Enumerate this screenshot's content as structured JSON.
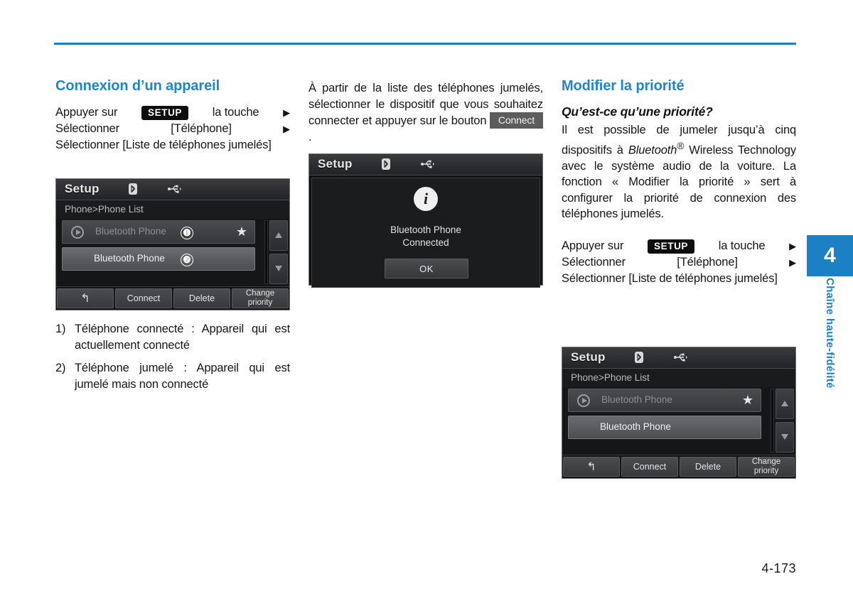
{
  "page": {
    "number": "4-173",
    "accent_color": "#1b81c4",
    "chapter_tab_number": "4",
    "chapter_tab_label": "Chaîne haute-fidélité"
  },
  "left_column": {
    "title": "Connexion d’un appareil",
    "steps": [
      {
        "before": "Appuyer sur",
        "badge": "SETUP",
        "after": "la touche",
        "arrow": "▶"
      },
      {
        "before": "Sélectionner",
        "badge": null,
        "after": "[Téléphone]",
        "arrow": "▶"
      }
    ],
    "step_last": "Sélectionner [Liste de téléphones jumelés]",
    "numbered_items": [
      {
        "marker": "1)",
        "text": "Téléphone connecté : Appareil qui est actuellement connecté"
      },
      {
        "marker": "2)",
        "text": "Téléphone jumelé : Appareil qui est jumelé mais non connecté"
      }
    ]
  },
  "center_column": {
    "paragraph_before": "À partir de la liste des téléphones jumelés, sélectionner le dispositif que vous souhaitez connecter et appuyer sur le bouton",
    "inline_button": "Connect",
    "paragraph_after": "."
  },
  "right_column": {
    "title": "Modifier la priorité",
    "subtitle": "Qu’est-ce qu’une priorité?",
    "paragraph_parts": {
      "p1": "Il est possible de jumeler jusqu’à cinq dispositifs à",
      "italic_brand": "Bluetooth",
      "registered": "®",
      "p2": "Wireless Technology avec le système audio de la voiture. La fonction « Modifier la priorité » sert à configurer la priorité de connexion des téléphones jumelés."
    },
    "steps": [
      {
        "before": "Appuyer sur",
        "badge": "SETUP",
        "after": "la touche",
        "arrow": "▶"
      },
      {
        "before": "Sélectionner",
        "badge": null,
        "after": "[Téléphone]",
        "arrow": "▶"
      }
    ],
    "step_last": "Sélectionner [Liste de téléphones jumelés]"
  },
  "device_phone_list": {
    "title": "Setup",
    "status_icons": {
      "bluetooth": "bluetooth-icon",
      "usb": "usb-icon"
    },
    "breadcrumb": "Phone>Phone List",
    "rows": [
      {
        "label": "Bluetooth Phone",
        "callout": "❶",
        "favorite": "★",
        "state": "connected-dimmed"
      },
      {
        "label": "Bluetooth Phone",
        "callout": "❷",
        "favorite": "",
        "state": "paired-highlight"
      }
    ],
    "scroll_up": "▲",
    "scroll_down": "▼",
    "buttons": [
      {
        "label": "↰",
        "name": "back-button",
        "type": "icon"
      },
      {
        "label": "Connect",
        "name": "connect-button",
        "type": "text"
      },
      {
        "label": "Delete",
        "name": "delete-button",
        "type": "text"
      },
      {
        "label": "Change\npriority",
        "label_line1": "Change",
        "label_line2": "priority",
        "name": "change-priority-button",
        "type": "text2"
      }
    ]
  },
  "device_phone_list_right": {
    "title": "Setup",
    "breadcrumb": "Phone>Phone List",
    "rows": [
      {
        "label": "Bluetooth Phone",
        "favorite": "★",
        "state": "connected-dimmed"
      },
      {
        "label": "Bluetooth Phone",
        "favorite": "",
        "state": "paired-highlight"
      }
    ],
    "scroll_up": "▲",
    "scroll_down": "▼",
    "buttons": [
      {
        "label": "↰",
        "name": "back-button"
      },
      {
        "label": "Connect",
        "name": "connect-button"
      },
      {
        "label": "Delete",
        "name": "delete-button"
      },
      {
        "label_line1": "Change",
        "label_line2": "priority",
        "name": "change-priority-button"
      }
    ]
  },
  "device_popup": {
    "title": "Setup",
    "info_glyph": "i",
    "message_line1": "Bluetooth Phone",
    "message_line2": "Connected",
    "ok_label": "OK"
  }
}
